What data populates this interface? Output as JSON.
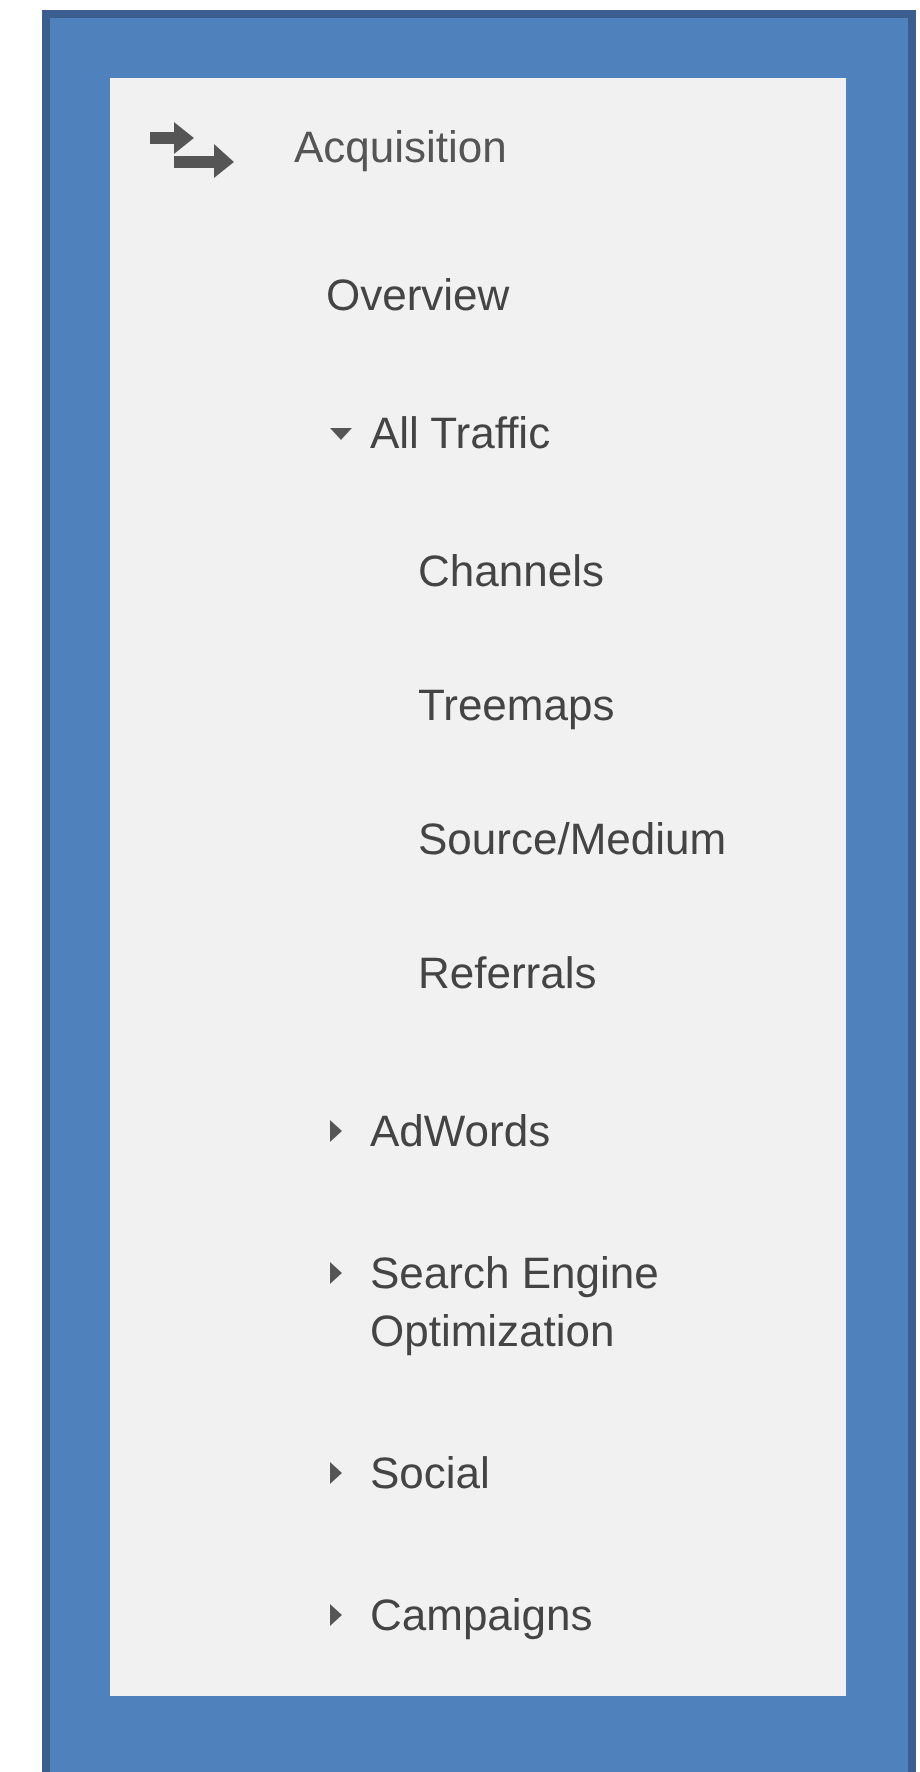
{
  "section": {
    "title": "Acquisition"
  },
  "items": [
    {
      "kind": "link",
      "label": "Overview"
    },
    {
      "kind": "group",
      "label": "All Traffic",
      "expanded": true,
      "children": [
        {
          "label": "Channels"
        },
        {
          "label": "Treemaps"
        },
        {
          "label": "Source/Medium"
        },
        {
          "label": "Referrals"
        }
      ]
    },
    {
      "kind": "group",
      "label": "AdWords",
      "expanded": false
    },
    {
      "kind": "group",
      "label": "Search Engine Optimization",
      "expanded": false
    },
    {
      "kind": "group",
      "label": "Social",
      "expanded": false
    },
    {
      "kind": "group",
      "label": "Campaigns",
      "expanded": false
    }
  ]
}
